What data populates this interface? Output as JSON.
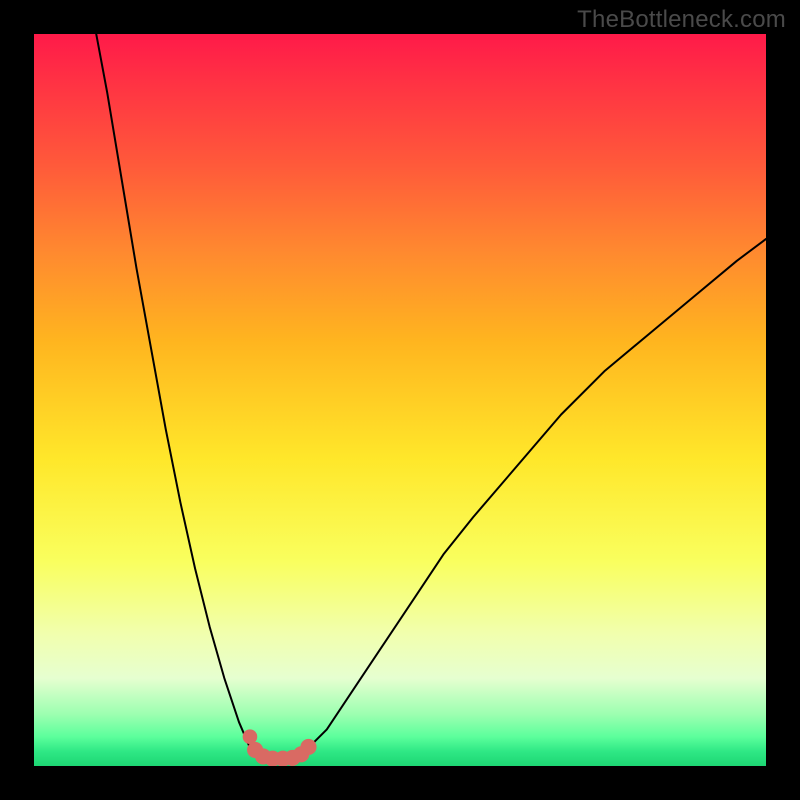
{
  "watermark": "TheBottleneck.com",
  "chart_data": {
    "type": "line",
    "title": "",
    "xlabel": "",
    "ylabel": "",
    "xlim": [
      0,
      100
    ],
    "ylim": [
      0,
      100
    ],
    "grid": false,
    "legend": false,
    "notes": "Bottleneck curve: two branches descending to a minimum near x≈32–37, y≈0. Background encodes value: red=high bottleneck, green=low.",
    "series": [
      {
        "name": "left-branch",
        "x": [
          8.5,
          10,
          12,
          14,
          16,
          18,
          20,
          22,
          24,
          26,
          28,
          29.5
        ],
        "y": [
          100,
          92,
          80,
          68,
          57,
          46,
          36,
          27,
          19,
          12,
          6,
          2.5
        ]
      },
      {
        "name": "right-branch",
        "x": [
          37.5,
          40,
          44,
          48,
          52,
          56,
          60,
          66,
          72,
          78,
          84,
          90,
          96,
          100
        ],
        "y": [
          2.5,
          5,
          11,
          17,
          23,
          29,
          34,
          41,
          48,
          54,
          59,
          64,
          69,
          72
        ]
      },
      {
        "name": "bottom-flat",
        "x": [
          30,
          31,
          32,
          33,
          34,
          35,
          36,
          37
        ],
        "y": [
          2,
          1.3,
          1,
          1,
          1,
          1,
          1.3,
          2
        ]
      }
    ],
    "markers": [
      {
        "x": 29.5,
        "y": 4.0,
        "r": 1.0
      },
      {
        "x": 30.2,
        "y": 2.2,
        "r": 1.1
      },
      {
        "x": 31.3,
        "y": 1.3,
        "r": 1.1
      },
      {
        "x": 32.6,
        "y": 1.0,
        "r": 1.1
      },
      {
        "x": 34.0,
        "y": 1.0,
        "r": 1.1
      },
      {
        "x": 35.3,
        "y": 1.1,
        "r": 1.1
      },
      {
        "x": 36.5,
        "y": 1.6,
        "r": 1.1
      },
      {
        "x": 37.5,
        "y": 2.6,
        "r": 1.1
      }
    ],
    "gradient_stops": [
      {
        "pct": 0,
        "color": "#ff1a49"
      },
      {
        "pct": 18,
        "color": "#ff5a3a"
      },
      {
        "pct": 42,
        "color": "#ffb51f"
      },
      {
        "pct": 72,
        "color": "#f9ff5e"
      },
      {
        "pct": 93,
        "color": "#9bffb0"
      },
      {
        "pct": 100,
        "color": "#1dd673"
      }
    ],
    "marker_color": "#d96a63",
    "curve_color": "#000000"
  }
}
